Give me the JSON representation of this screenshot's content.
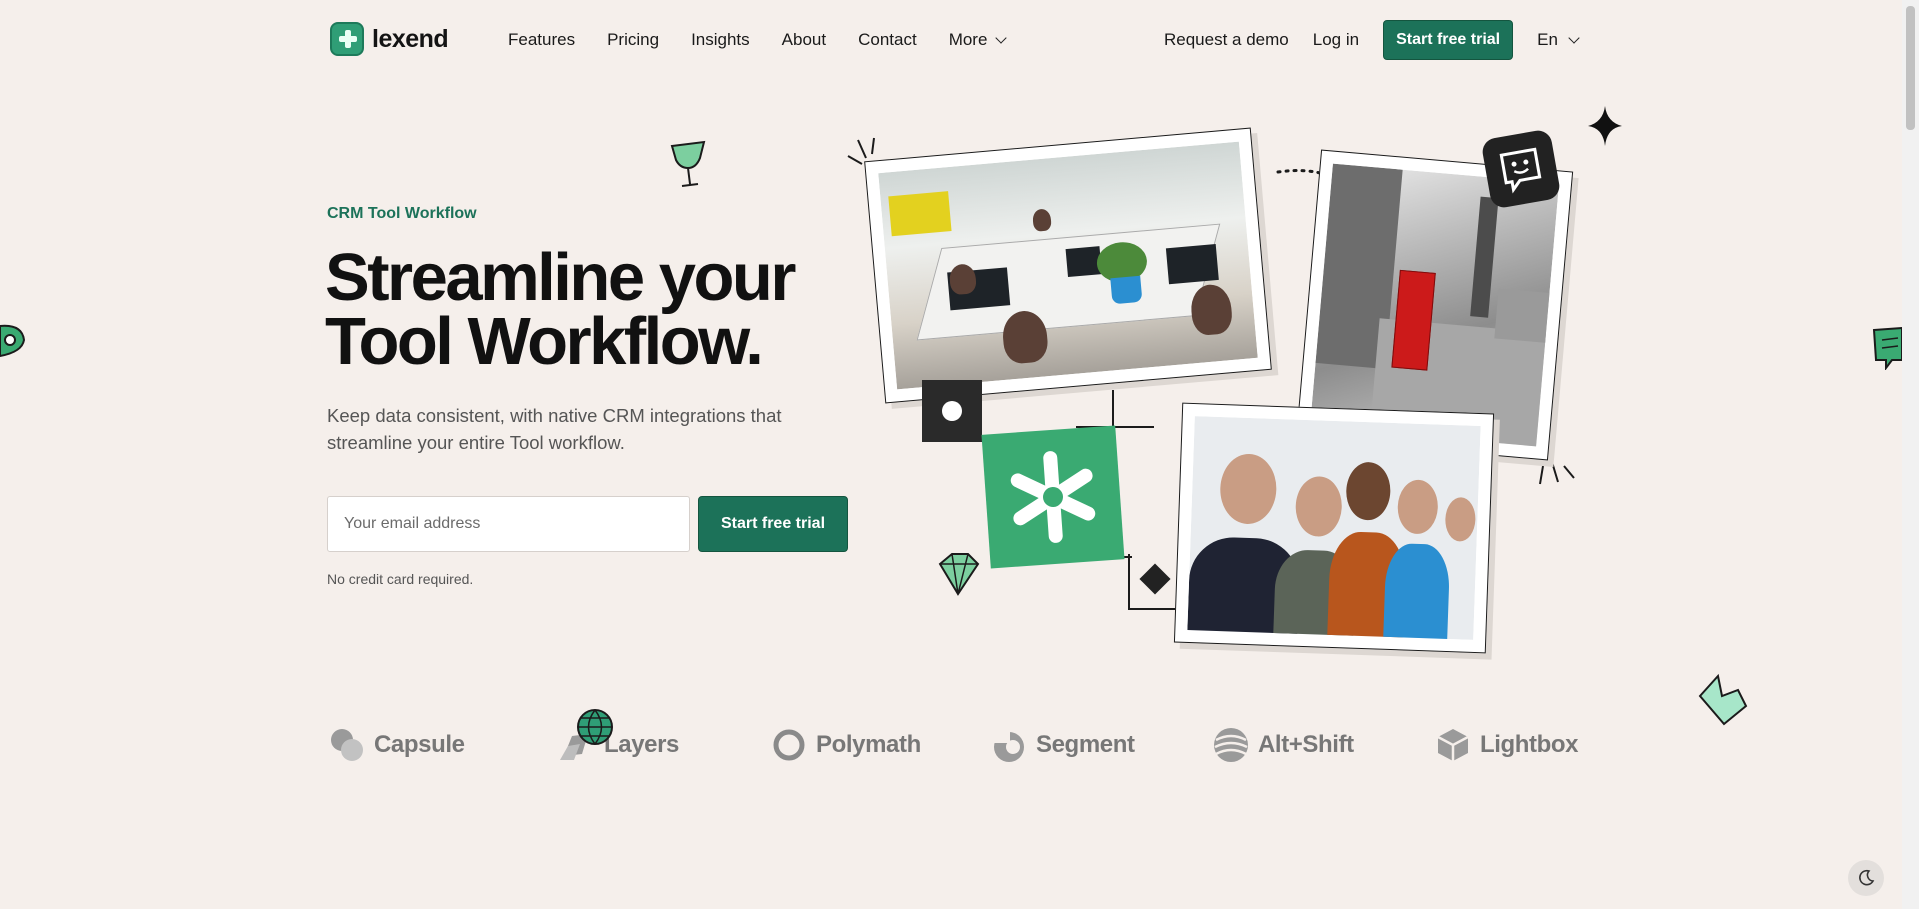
{
  "brand": {
    "name": "lexend"
  },
  "nav": {
    "links": [
      "Features",
      "Pricing",
      "Insights",
      "About",
      "Contact"
    ],
    "more_label": "More",
    "request_demo": "Request a demo",
    "login": "Log in",
    "trial": "Start free trial",
    "language": "En"
  },
  "hero": {
    "eyebrow": "CRM Tool Workflow",
    "headline": "Streamline your Tool Workflow.",
    "subtext": "Keep data consistent, with native CRM integrations that streamline your entire Tool workflow.",
    "email_placeholder": "Your email address",
    "cta": "Start free trial",
    "note": "No credit card required."
  },
  "logos": [
    "Capsule",
    "Layers",
    "Polymath",
    "Segment",
    "Alt+Shift",
    "Lightbox"
  ],
  "colors": {
    "accent": "#1c7259",
    "accent_light": "#3aaa72",
    "background": "#f5efeb"
  }
}
